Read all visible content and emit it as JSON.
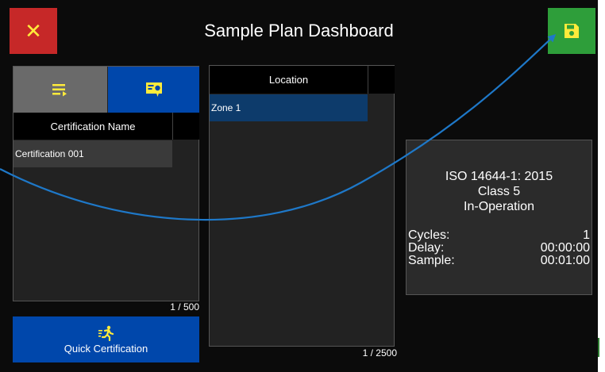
{
  "header": {
    "title": "Sample Plan Dashboard",
    "close_icon": "close-icon",
    "save_icon": "floppy-disk-save-icon"
  },
  "left_panel": {
    "tabs": [
      {
        "icon": "list-arrow-icon",
        "active": false
      },
      {
        "icon": "certificate-icon",
        "active": true
      }
    ],
    "column_header": "Certification Name",
    "rows": [
      "Certification 001"
    ],
    "count": "1 / 500"
  },
  "quick_certification": {
    "label": "Quick Certification",
    "icon": "running-person-icon"
  },
  "location_panel": {
    "column_header": "Location",
    "rows": [
      "Zone 1"
    ],
    "selected_row": "Zone 1",
    "count": "1 / 2500"
  },
  "info": {
    "standard": "ISO 14644-1: 2015",
    "class": "Class 5",
    "state": "In-Operation",
    "cycles_label": "Cycles:",
    "cycles_value": "1",
    "delay_label": "Delay:",
    "delay_value": "00:00:00",
    "sample_label": "Sample:",
    "sample_value": "00:01:00"
  },
  "colors": {
    "background": "#0b0b0b",
    "close_button": "#c62828",
    "save_button": "#2e9e3a",
    "accent_blue": "#0047ab",
    "selected_row": "#0d3b6b",
    "icon_yellow": "#ffeb3b",
    "annotation_arrow": "#1e78c8"
  }
}
